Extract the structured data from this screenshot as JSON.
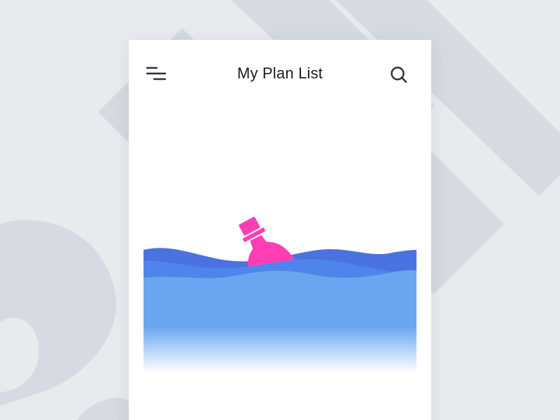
{
  "header": {
    "title": "My Plan List",
    "menu_icon": "menu-icon",
    "search_icon": "search-icon"
  },
  "illustration": {
    "subject": "bottle-in-sea-illustration",
    "bottle_icon": "message-bottle-icon"
  },
  "colors": {
    "background": "#e8ebee",
    "background_shapes": "#d6dae2",
    "card": "#ffffff",
    "title_text": "#1b1b1f",
    "icon_stroke": "#2a2f3a",
    "wave_back": "#4a72e0",
    "wave_mid": "#4f85ea",
    "wave_front": "#6aa6f0",
    "bottle": "#ff3eb5"
  }
}
